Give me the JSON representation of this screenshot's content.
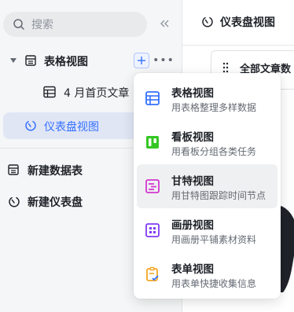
{
  "search": {
    "placeholder": "搜索"
  },
  "sidebar": {
    "tree": {
      "table_view": {
        "label": "表格视图"
      },
      "april_homepage": {
        "label": "4 月首页文章"
      },
      "dashboard_view": {
        "label": "仪表盘视图"
      }
    },
    "actions": {
      "new_table": "新建数据表",
      "new_dashboard": "新建仪表盘"
    }
  },
  "content": {
    "header_title": "仪表盘视图",
    "card_title": "全部文章数"
  },
  "popup": {
    "items": [
      {
        "title": "表格视图",
        "desc": "用表格整理多样数据",
        "icon": "grid-view-icon",
        "color": "#3370ff"
      },
      {
        "title": "看板视图",
        "desc": "用看板分组各类任务",
        "icon": "kanban-view-icon",
        "color": "#34c724"
      },
      {
        "title": "甘特视图",
        "desc": "用甘特图跟踪时间节点",
        "icon": "gantt-view-icon",
        "color": "#d136d1"
      },
      {
        "title": "画册视图",
        "desc": "用画册平铺素材资料",
        "icon": "gallery-view-icon",
        "color": "#7f3bf5"
      },
      {
        "title": "表单视图",
        "desc": "用表单快捷收集信息",
        "icon": "form-view-icon",
        "color": "#f5a623"
      }
    ]
  },
  "colors": {
    "accent": "#3370ff",
    "selected_bg": "#e1e6f5"
  }
}
